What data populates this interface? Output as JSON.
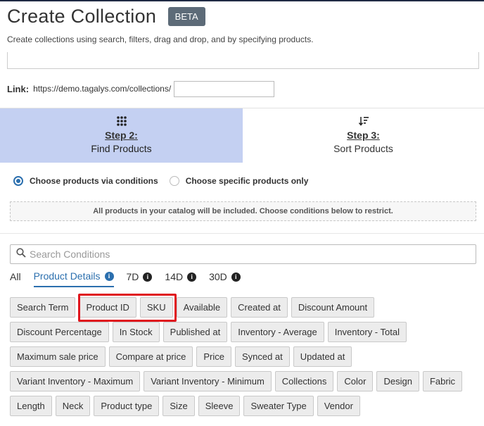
{
  "header": {
    "title": "Create Collection",
    "badge": "BETA",
    "subtitle": "Create collections using search, filters, drag and drop, and by specifying products."
  },
  "link": {
    "label": "Link:",
    "url": "https://demo.tagalys.com/collections/",
    "value": ""
  },
  "steps": [
    {
      "number": "Step 2:",
      "name": "Find Products",
      "icon": "grid-dots-icon",
      "active": true
    },
    {
      "number": "Step 3:",
      "name": "Sort Products",
      "icon": "sort-icon",
      "active": false
    }
  ],
  "mode": {
    "option_conditions": "Choose products via conditions",
    "option_specific": "Choose specific products only",
    "selected": "conditions"
  },
  "note": "All products in your catalog will be included. Choose conditions below to restrict.",
  "search": {
    "placeholder": "Search Conditions"
  },
  "tabs": [
    {
      "label": "All",
      "active": false
    },
    {
      "label": "Product Details",
      "active": true
    },
    {
      "label": "7D",
      "active": false
    },
    {
      "label": "14D",
      "active": false
    },
    {
      "label": "30D",
      "active": false
    }
  ],
  "chips": {
    "row1": [
      "Search Term",
      "Product ID",
      "SKU",
      "Available",
      "Created at",
      "Discount Amount"
    ],
    "row2": [
      "Discount Percentage",
      "In Stock",
      "Published at",
      "Inventory - Average",
      "Inventory - Total"
    ],
    "row3": [
      "Maximum sale price",
      "Compare at price",
      "Price",
      "Synced at",
      "Updated at"
    ],
    "row4": [
      "Variant Inventory - Maximum",
      "Variant Inventory - Minimum",
      "Collections",
      "Color",
      "Design",
      "Fabric"
    ],
    "row5": [
      "Length",
      "Neck",
      "Product type",
      "Size",
      "Sleeve",
      "Sweater Type",
      "Vendor"
    ]
  },
  "colors": {
    "accent": "#2b6fae",
    "step_active_bg": "#c4d0f2",
    "highlight": "#e0161e",
    "badge_bg": "#5d6b78"
  }
}
